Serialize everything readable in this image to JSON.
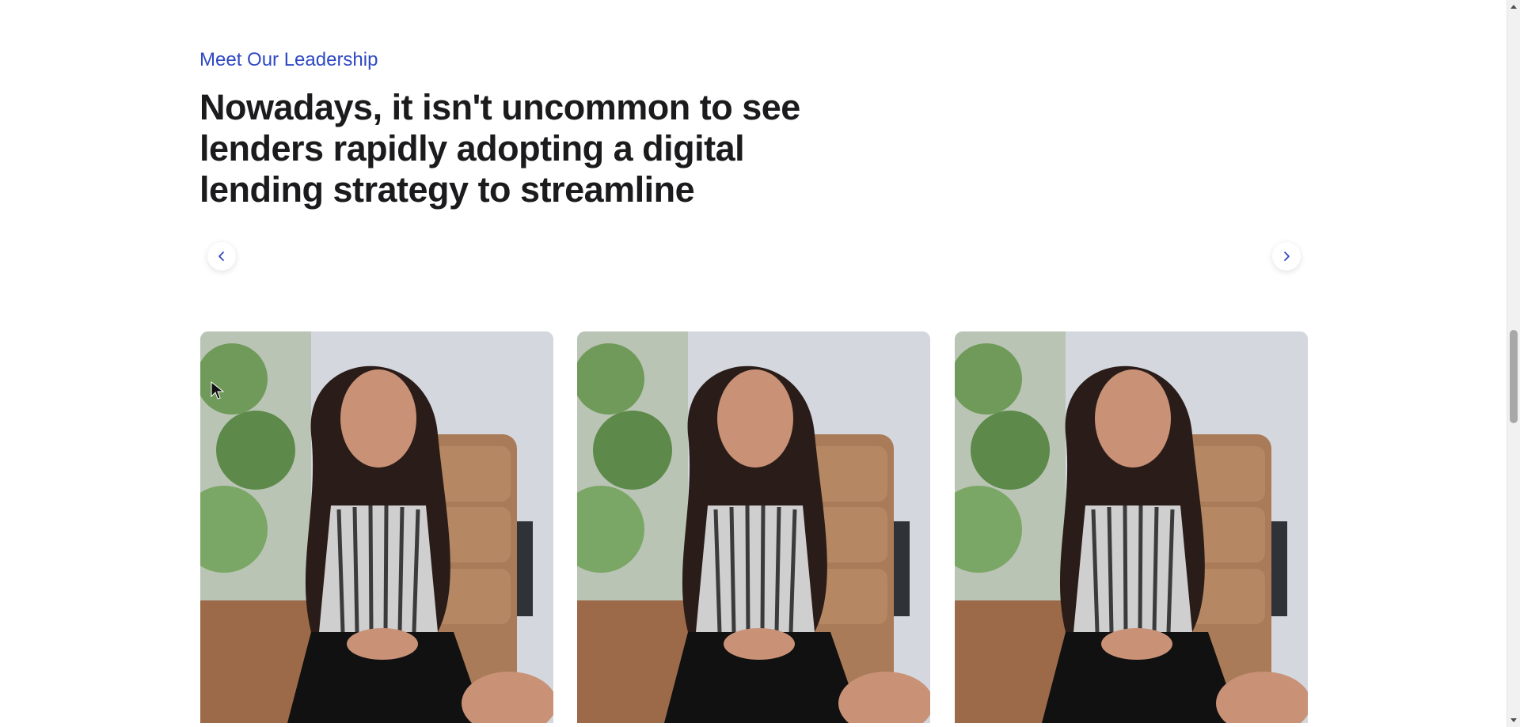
{
  "section": {
    "eyebrow": "Meet Our Leadership",
    "headline": "Nowadays, it isn't uncommon to see lenders rapidly adopting a digital lending strategy to streamline"
  },
  "carousel": {
    "prev_icon": "chevron-left-icon",
    "next_icon": "chevron-right-icon",
    "cards": [
      {
        "image": "portrait of smiling woman seated in office chair"
      },
      {
        "image": "portrait of smiling woman seated in office chair"
      },
      {
        "image": "portrait of smiling woman seated in office chair"
      }
    ]
  },
  "colors": {
    "accent": "#2f49c4",
    "heading": "#1b1b1d",
    "background": "#ffffff"
  }
}
